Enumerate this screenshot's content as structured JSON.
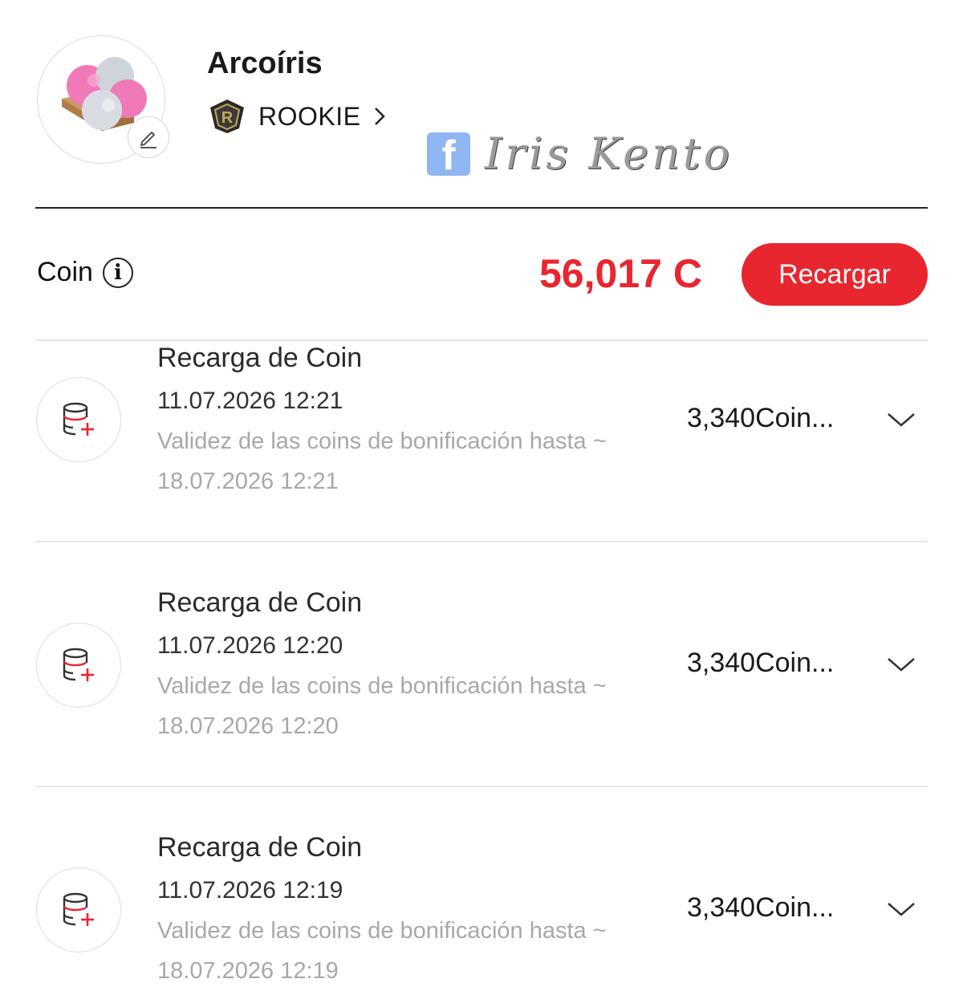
{
  "profile": {
    "name": "Arcoíris",
    "rank": "ROOKIE",
    "rank_badge_letter": "R"
  },
  "watermark": {
    "icon": "facebook-icon",
    "fb_letter": "f",
    "text": "Iris Kento"
  },
  "wallet": {
    "label": "Coin",
    "balance": "56,017 C",
    "recharge_label": "Recargar",
    "accent_color": "#e8262f"
  },
  "transactions": [
    {
      "title": "Recarga de Coin",
      "date": "11.07.2026 12:21",
      "note": "Validez de las coins de bonificación hasta ~",
      "note_date": "18.07.2026 12:21",
      "amount": "3,340Coin..."
    },
    {
      "title": "Recarga de Coin",
      "date": "11.07.2026 12:20",
      "note": "Validez de las coins de bonificación hasta ~",
      "note_date": "18.07.2026 12:20",
      "amount": "3,340Coin..."
    },
    {
      "title": "Recarga de Coin",
      "date": "11.07.2026 12:19",
      "note": "Validez de las coins de bonificación hasta ~",
      "note_date": "18.07.2026 12:19",
      "amount": "3,340Coin..."
    }
  ]
}
